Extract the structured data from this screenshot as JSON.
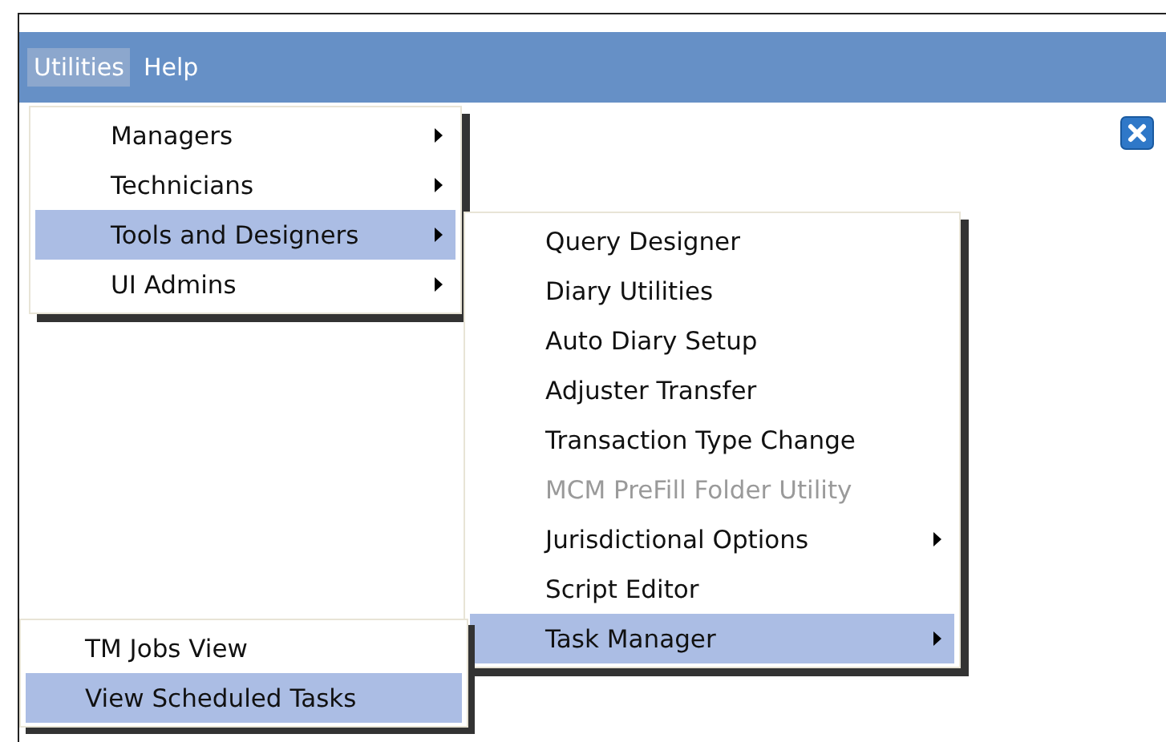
{
  "menu_bar": [
    {
      "label": "Utilities",
      "selected": true
    },
    {
      "label": "Help",
      "selected": false
    }
  ],
  "menus": [
    {
      "items": [
        {
          "label": "Managers",
          "selected": false,
          "submenu": true,
          "disabled": false
        },
        {
          "label": "Technicians",
          "selected": false,
          "submenu": true,
          "disabled": false
        },
        {
          "label": "Tools and Designers",
          "selected": true,
          "submenu": true,
          "disabled": false
        },
        {
          "label": "UI Admins",
          "selected": false,
          "submenu": true,
          "disabled": false
        }
      ]
    },
    {
      "items": [
        {
          "label": "Query Designer",
          "selected": false,
          "submenu": false,
          "disabled": false
        },
        {
          "label": "Diary Utilities",
          "selected": false,
          "submenu": false,
          "disabled": false
        },
        {
          "label": "Auto Diary Setup",
          "selected": false,
          "submenu": false,
          "disabled": false
        },
        {
          "label": "Adjuster Transfer",
          "selected": false,
          "submenu": false,
          "disabled": false
        },
        {
          "label": "Transaction Type Change",
          "selected": false,
          "submenu": false,
          "disabled": false
        },
        {
          "label": "MCM PreFill Folder Utility",
          "selected": false,
          "submenu": false,
          "disabled": true
        },
        {
          "label": "Jurisdictional Options",
          "selected": false,
          "submenu": true,
          "disabled": false
        },
        {
          "label": "Script Editor",
          "selected": false,
          "submenu": false,
          "disabled": false
        },
        {
          "label": "Task Manager",
          "selected": true,
          "submenu": true,
          "disabled": false
        }
      ]
    },
    {
      "items": [
        {
          "label": "TM Jobs View",
          "selected": false,
          "submenu": false,
          "disabled": false
        },
        {
          "label": "View Scheduled Tasks",
          "selected": true,
          "submenu": false,
          "disabled": false
        }
      ]
    }
  ]
}
